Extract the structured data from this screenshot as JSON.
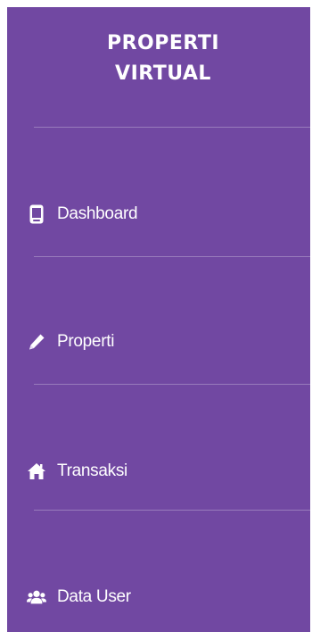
{
  "brand": {
    "line1": "PROPERTI",
    "line2": "VIRTUAL"
  },
  "nav": {
    "items": [
      {
        "label": "Dashboard",
        "icon": "tablet-icon"
      },
      {
        "label": "Properti",
        "icon": "pencil-icon"
      },
      {
        "label": "Transaksi",
        "icon": "home-icon"
      },
      {
        "label": "Data User",
        "icon": "users-icon"
      }
    ]
  },
  "colors": {
    "sidebar_bg": "#7148a2",
    "text": "#ffffff"
  }
}
